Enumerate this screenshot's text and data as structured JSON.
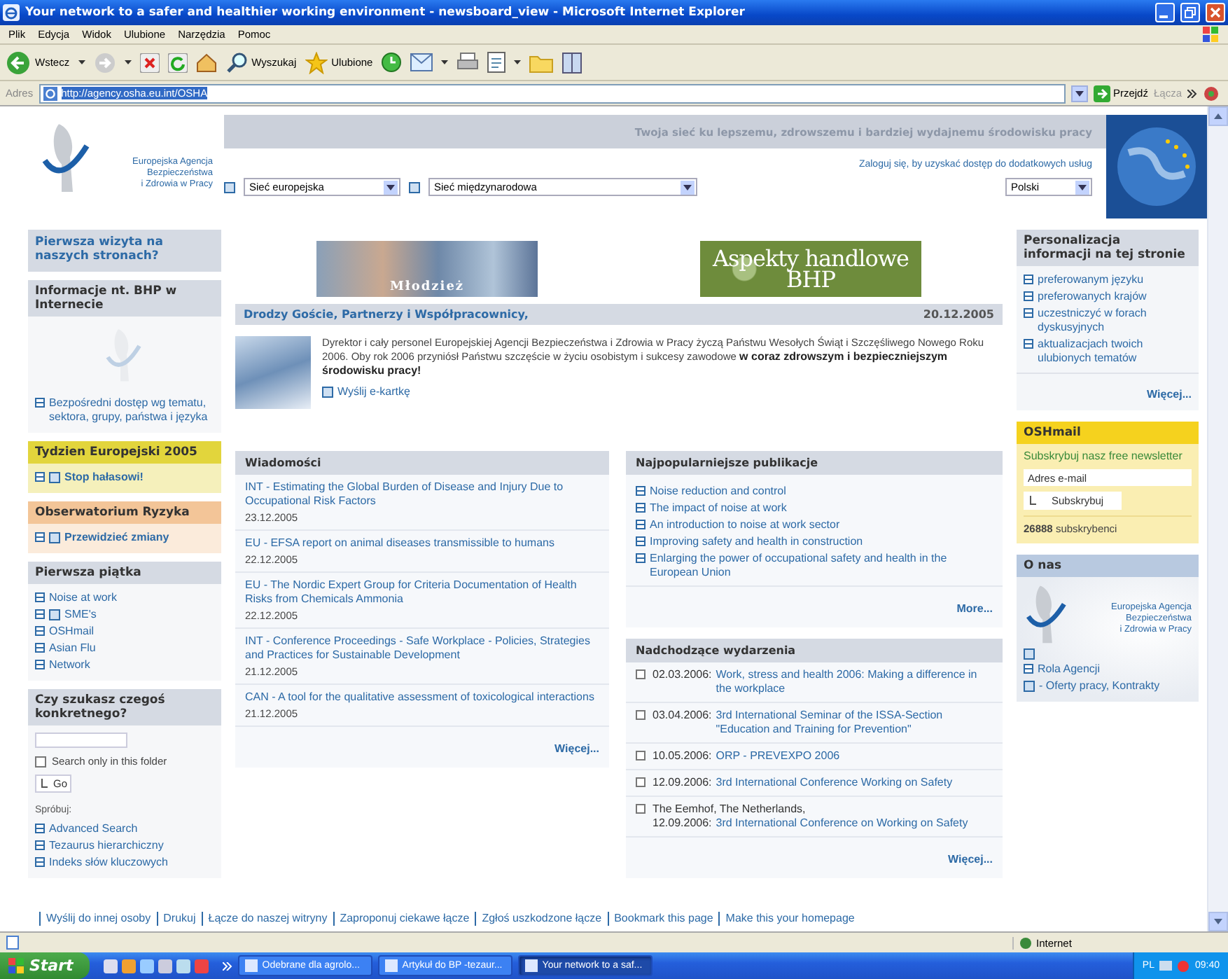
{
  "window": {
    "title": "Your network to a safer and healthier working environment - newsboard_view - Microsoft Internet Explorer"
  },
  "menu_bar": [
    "Plik",
    "Edycja",
    "Widok",
    "Ulubione",
    "Narzędzia",
    "Pomoc"
  ],
  "toolbar": {
    "back": "Wstecz",
    "search": "Wyszukaj",
    "favorites": "Ulubione"
  },
  "address_bar": {
    "label": "Adres",
    "url": "http://agency.osha.eu.int/OSHA",
    "url_selected": true,
    "go": "Przejdź",
    "links": "Łącza"
  },
  "header": {
    "slogan": "Twoja sieć ku lepszemu, zdrowszemu i bardziej wydajnemu środowisku pracy",
    "agency_name": [
      "Europejska Agencja",
      "Bezpieczeństwa",
      "i Zdrowia w Pracy"
    ],
    "login": "Zaloguj się, by uzyskać dostęp do dodatkowych usług",
    "network_selects": [
      "Sieć europejska",
      "Sieć międzynarodowa"
    ],
    "language": "Polski"
  },
  "left_sidebar": [
    {
      "kind": "link",
      "title": "Pierwsza wizyta na naszych stronach?",
      "color": "#d5dae3"
    },
    {
      "kind": "heading",
      "title": "Informacje nt. BHP w Internecie",
      "color": "#d5dae3",
      "has_picture": true,
      "items": [
        {
          "text": "Bezpośredni dostęp wg tematu, sektora, grupy, państwa i języka",
          "doc_icon": false,
          "strong": false
        }
      ]
    },
    {
      "kind": "heading",
      "title": "Tydzien Europejski 2005",
      "color": "#e2d53c",
      "items": [
        {
          "text": "Stop hałasowi!",
          "doc_icon": true,
          "strong": true
        }
      ]
    },
    {
      "kind": "heading",
      "title": "Obserwatorium Ryzyka",
      "color": "#f3c598",
      "items": [
        {
          "text": "Przewidzieć zmiany",
          "doc_icon": true,
          "strong": true
        }
      ]
    },
    {
      "kind": "heading",
      "title": "Pierwsza piątka",
      "color": "#d5dae3",
      "items": [
        {
          "text": "Noise at work",
          "doc_icon": false,
          "strong": false
        },
        {
          "text": "SME's",
          "doc_icon": true,
          "strong": false
        },
        {
          "text": "OSHmail",
          "doc_icon": false,
          "strong": false
        },
        {
          "text": "Asian Flu",
          "doc_icon": false,
          "strong": false
        },
        {
          "text": "Network",
          "doc_icon": false,
          "strong": false
        }
      ]
    },
    {
      "kind": "search",
      "title": "Czy szukasz czegoś konkretnego?",
      "color": "#d5dae3",
      "search": {
        "checkbox_label": "Search only in this folder",
        "checked": false,
        "button": "Go",
        "try_label": "Spróbuj:",
        "links": [
          "Advanced Search",
          "Tezaurus hierarchiczny",
          "Indeks słów kluczowych"
        ]
      }
    }
  ],
  "banners": [
    {
      "label": "Młodzież"
    },
    {
      "label": "Aspekty handlowe BHP"
    }
  ],
  "greeting": {
    "title": "Drodzy Goście, Partnerzy i Współpracownicy,",
    "date": "20.12.2005",
    "body": "Dyrektor i cały personel Europejskiej Agencji Bezpieczeństwa i Zdrowia w Pracy życzą Państwu Wesołych Świąt i Szczęśliwego Nowego Roku 2006. Oby rok 2006 przyniósł Państwu szczęście w życiu osobistym i sukcesy zawodowe **w coraz zdrowszym i bezpieczniejszym środowisku pracy!**",
    "link": "Wyślij e-kartkę"
  },
  "news": {
    "title": "Wiadomości",
    "items": [
      {
        "title": "INT - Estimating the Global Burden of Disease and Injury Due to Occupational Risk Factors",
        "date": "23.12.2005"
      },
      {
        "title": "EU - EFSA report on animal diseases transmissible to humans",
        "date": "22.12.2005"
      },
      {
        "title": "EU - The Nordic Expert Group for Criteria Documentation of Health Risks from Chemicals Ammonia",
        "date": "22.12.2005"
      },
      {
        "title": "INT - Conference Proceedings - Safe Workplace - Policies, Strategies and Practices for Sustainable Development",
        "date": "21.12.2005"
      },
      {
        "title": "CAN - A tool for the qualitative assessment of toxicological interactions",
        "date": "21.12.2005"
      }
    ],
    "more": "Więcej..."
  },
  "publications": {
    "title": "Najpopularniejsze publikacje",
    "items": [
      "Noise reduction and control",
      "The impact of noise at work",
      "An introduction to noise at work sector",
      "Improving safety and health in construction",
      "Enlarging the power of occupational safety and health in the European Union"
    ],
    "more": "More..."
  },
  "events": {
    "title": "Nadchodzące wydarzenia",
    "items": [
      {
        "date": "02.03.2006:",
        "title": "Work, stress and health 2006: Making a difference in the workplace"
      },
      {
        "date": "03.04.2006:",
        "title": "3rd International Seminar of the ISSA-Section \"Education and Training for Prevention\""
      },
      {
        "date": "10.05.2006:",
        "title": "ORP - PREVEXPO 2006"
      },
      {
        "date": "12.09.2006:",
        "title": "3rd International Conference Working on Safety"
      },
      {
        "location": "The Eemhof, The Netherlands,",
        "date": "12.09.2006:",
        "title": "3rd International Conference on Working on Safety"
      }
    ],
    "more": "Więcej..."
  },
  "personalization": {
    "title": "Personalizacja informacji na tej stronie",
    "items": [
      "preferowanym języku",
      "preferowanych krajów",
      "uczestniczyć w forach dyskusyjnych",
      "aktualizacjach twoich ulubionych tematów"
    ],
    "more": "Więcej..."
  },
  "oshmail": {
    "title": "OSHmail",
    "text": "Subskrybuj nasz free newsletter",
    "placeholder": "Adres e-mail",
    "button": "Subskrybuj",
    "count": "26888",
    "count_label": "subskrybenci"
  },
  "about": {
    "title": "O nas",
    "agency_name": [
      "Europejska Agencja",
      "Bezpieczeństwa",
      "i Zdrowia w Pracy"
    ],
    "links": [
      {
        "text": "Rola Agencji",
        "doc_icon": false
      },
      {
        "text": "- Oferty pracy, Kontrakty",
        "doc_icon": true
      }
    ]
  },
  "footer_links": [
    "Wyślij do innej osoby",
    "Drukuj",
    "Łącze do naszej witryny",
    "Zaproponuj ciekawe łącze",
    "Zgłoś uszkodzone łącze",
    "Bookmark this page",
    "Make this your homepage"
  ],
  "status_bar": {
    "zone": "Internet"
  },
  "taskbar": {
    "start": "Start",
    "tasks": [
      {
        "label": "Odebrane dla agrolo...",
        "selected": false
      },
      {
        "label": "Artykuł do BP -tezaur...",
        "selected": false
      },
      {
        "label": "Your network to a saf...",
        "selected": true
      }
    ],
    "language": "PL",
    "clock": "09:40"
  }
}
